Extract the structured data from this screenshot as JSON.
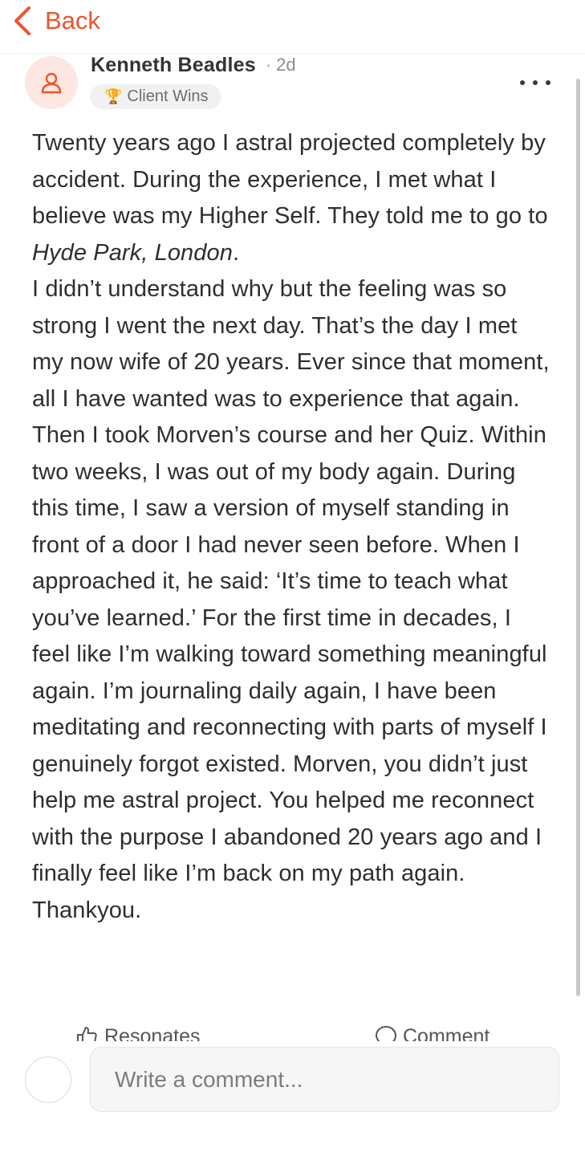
{
  "nav": {
    "back_label": "Back",
    "icons": {
      "back": "chevron-left-icon"
    },
    "accent_color": "#f0522c"
  },
  "post": {
    "author": "Kenneth Beadles",
    "separator": "·",
    "time_ago": "2d",
    "badge_label": "Client Wins",
    "badge_icon": "trophy-icon",
    "avatar_icon": "user-icon",
    "more_icon": "more-horizontal-icon",
    "body": {
      "line1_a": "Twenty years ago I astral projected completely by accident. During the experience, I met what I believe was my Higher Self. They told me to go to ",
      "line1_em": "Hyde Park, London",
      "line1_b": ".",
      "para2": "I didn’t understand why but the feeling was so strong I went the next day. That’s the day I met my now wife of 20 years. Ever since that moment, all I have wanted was to experience that again. Then I took Morven’s course and her Quiz. Within two weeks, I was out of my body again. During this time, I saw a version of myself standing in front of a door I had never seen before. When I approached it, he said: ‘It’s time to teach what you’ve learned.’ For the first time in decades, I feel like I’m walking toward something meaningful again. I’m journaling daily again, I have been meditating and reconnecting with parts of myself I genuinely forgot existed. Morven, you didn’t just help me astral project. You helped me reconnect with the purpose I abandoned 20 years ago and I finally feel like I’m back on my path again. Thankyou."
    },
    "actions": {
      "resonates_label": "Resonates",
      "comment_label": "Comment",
      "resonates_icon": "thumbs-up-icon",
      "comment_icon": "comment-bubble-icon"
    }
  },
  "composer": {
    "placeholder": "Write a comment..."
  }
}
